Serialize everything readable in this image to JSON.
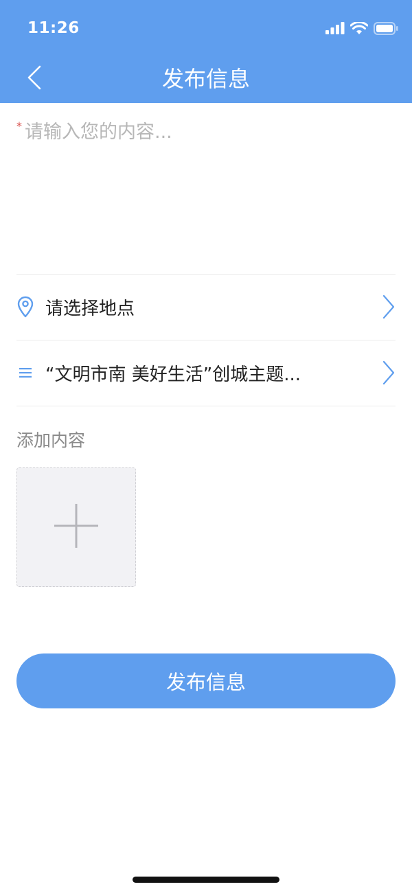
{
  "status_bar": {
    "time": "11:26",
    "icons": [
      "signal-icon",
      "wifi-icon",
      "battery-icon"
    ]
  },
  "nav": {
    "back_icon": "chevron-left-icon",
    "title": "发布信息"
  },
  "content": {
    "required_mark": "*",
    "placeholder": "请输入您的内容...",
    "value": ""
  },
  "location_row": {
    "icon": "location-pin-icon",
    "label": "请选择地点",
    "chevron": "chevron-right-icon"
  },
  "topic_row": {
    "icon": "list-icon",
    "label": "“文明市南 美好生活”创城主题...",
    "chevron": "chevron-right-icon"
  },
  "attachments": {
    "section_label": "添加内容",
    "add_icon": "plus-icon"
  },
  "submit": {
    "label": "发布信息"
  },
  "colors": {
    "primary": "#5f9eee",
    "required": "#d9534f",
    "placeholder": "#b7b7b7",
    "divider": "#ececec",
    "add_box_bg": "#f2f2f5"
  }
}
